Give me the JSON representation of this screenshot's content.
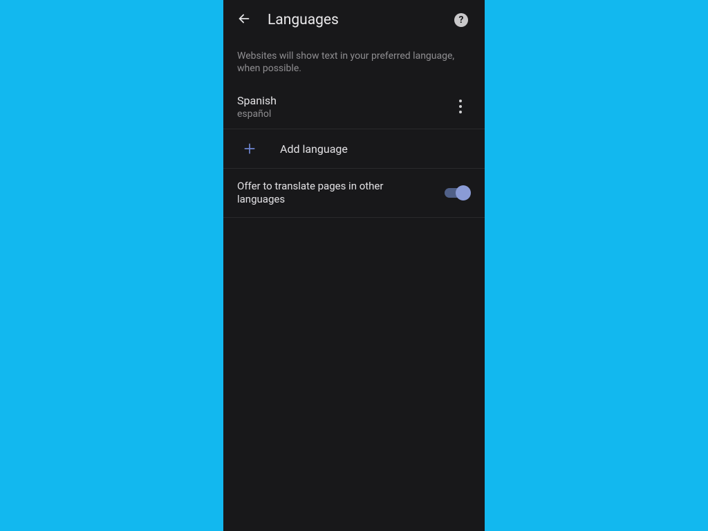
{
  "header": {
    "title": "Languages"
  },
  "description": "Websites will show text in your preferred language, when possible.",
  "languages": [
    {
      "name": "Spanish",
      "native": "español"
    }
  ],
  "add_language_label": "Add language",
  "translate_toggle": {
    "label": "Offer to translate pages in other languages",
    "enabled": true
  }
}
